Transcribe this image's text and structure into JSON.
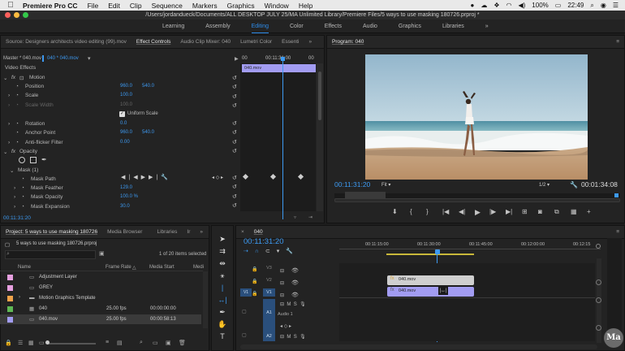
{
  "menubar": {
    "app": "Premiere Pro CC",
    "items": [
      "File",
      "Edit",
      "Clip",
      "Sequence",
      "Markers",
      "Graphics",
      "Window",
      "Help"
    ],
    "battery": "100%",
    "time": "22:49"
  },
  "titlebar": {
    "path": "/Users/jordandueck/Documents/ALL DESKTOP JULY 25/MA Unlimited Library/Premiere Files/5 ways to use masking 180726.prproj *"
  },
  "workspaces": {
    "items": [
      "Learning",
      "Assembly",
      "Editing",
      "Color",
      "Effects",
      "Audio",
      "Graphics",
      "Libraries"
    ],
    "more": "»"
  },
  "source_panel": {
    "tabs": [
      "Source: Designers architects video editing (99).mov",
      "Effect Controls",
      "Audio Clip Mixer: 040",
      "Lumetri Color",
      "Essenti"
    ],
    "more": "»"
  },
  "effect_controls": {
    "master": "Master * 040.mov",
    "clip": "040 * 040.mov",
    "section": "Video Effects",
    "motion": "Motion",
    "position": {
      "label": "Position",
      "x": "960.0",
      "y": "540.0"
    },
    "scale": {
      "label": "Scale",
      "value": "100.0"
    },
    "scale_width": {
      "label": "Scale Width",
      "value": "100.0"
    },
    "uniform_scale": "Uniform Scale",
    "rotation": {
      "label": "Rotation",
      "value": "0.0"
    },
    "anchor_point": {
      "label": "Anchor Point",
      "x": "960.0",
      "y": "540.0"
    },
    "anti_flicker": {
      "label": "Anti-flicker Filter",
      "value": "0.00"
    },
    "opacity": "Opacity",
    "mask": "Mask (1)",
    "mask_path": "Mask Path",
    "mask_feather": {
      "label": "Mask Feather",
      "value": "129.0"
    },
    "mask_opacity": {
      "label": "Mask Opacity",
      "value": "100.0 %"
    },
    "mask_expansion": {
      "label": "Mask Expansion",
      "value": "30.0"
    },
    "timecode": "00:11:31:20",
    "ruler": [
      "00",
      "00:11:31:00",
      "00"
    ],
    "clip_label": "040.mov"
  },
  "program": {
    "tab": "Program: 040",
    "timecode": "00:11:31:20",
    "fit": "Fit",
    "resolution": "1/2",
    "duration": "00:01:34:08"
  },
  "project": {
    "tabs": [
      "Project: 5 ways to use masking 180726",
      "Media Browser",
      "Libraries",
      "Ir"
    ],
    "more": "»",
    "file": "5 ways to use masking 180726.prproj",
    "count": "1 of 20 items selected",
    "columns": {
      "name": "Name",
      "frame_rate": "Frame Rate",
      "media_start": "Media Start",
      "media": "Medi"
    },
    "items": [
      {
        "name": "Adjustment Layer",
        "color": "#e7a0e0",
        "fps": "",
        "start": ""
      },
      {
        "name": "GREY",
        "color": "#e7a0e0",
        "fps": "",
        "start": ""
      },
      {
        "name": "Motion Graphics Template",
        "color": "#f0a24a",
        "fps": "",
        "start": ""
      },
      {
        "name": "040",
        "color": "#5fb855",
        "fps": "25.00 fps",
        "start": "00:00:00:00"
      },
      {
        "name": "040.mov",
        "color": "#a29cf2",
        "fps": "25.00 fps",
        "start": "00:00:58:13"
      }
    ]
  },
  "timeline": {
    "tab": "040",
    "timecode": "00:11:31:20",
    "ruler": [
      "00:11:15:00",
      "00:11:30:00",
      "00:11:45:00",
      "00:12:00:00",
      "00:12:15"
    ],
    "tracks": {
      "v3": "V3",
      "v2": "V2",
      "v1": "V1",
      "a1": "A1",
      "a2": "A2",
      "audio1": "Audio 1",
      "v1_src": "V1"
    },
    "clip_v2": "040.mov",
    "clip_v1": "040.mov"
  },
  "badge": "Ma"
}
